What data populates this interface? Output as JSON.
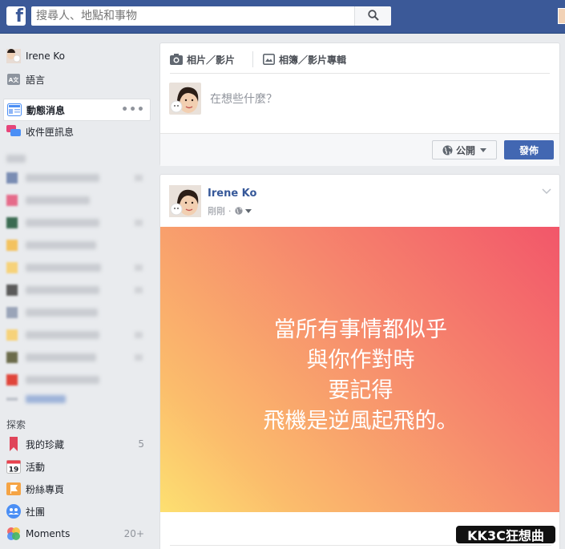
{
  "header": {
    "logo": "f",
    "search_placeholder": "搜尋人、地點和事物"
  },
  "sidebar": {
    "profile_name": "Irene Ko",
    "language": "語言",
    "news_feed": "動態消息",
    "inbox": "收件匣訊息",
    "more_dots": "•••",
    "explore_header": "探索",
    "explore": [
      {
        "label": "我的珍藏",
        "count": "5",
        "icon": "bookmark-icon",
        "color": "#e0455a"
      },
      {
        "label": "活動",
        "count": "",
        "icon": "calendar-icon",
        "color": "#e9414d"
      },
      {
        "label": "粉絲專頁",
        "count": "",
        "icon": "flag-icon",
        "color": "#f28b3a"
      },
      {
        "label": "社團",
        "count": "",
        "icon": "groups-icon",
        "color": "#4b8ff5"
      },
      {
        "label": "Moments",
        "count": "20+",
        "icon": "moments-icon",
        "color": "#e34a9a"
      }
    ],
    "calendar_day": "19"
  },
  "composer": {
    "tab_photo": "相片／影片",
    "tab_album": "相簿／影片專輯",
    "placeholder": "在想些什麼？",
    "privacy": "公開",
    "post_button": "發佈"
  },
  "post": {
    "author": "Irene Ko",
    "time": "剛剛",
    "lines": [
      "當所有事情都似乎",
      "與你作對時",
      "要記得",
      "飛機是逆風起飛的。"
    ]
  },
  "watermark": "KK3C狂想曲",
  "colors": {
    "brand": "#3b5998",
    "post_button": "#4267b2",
    "link": "#365899"
  }
}
